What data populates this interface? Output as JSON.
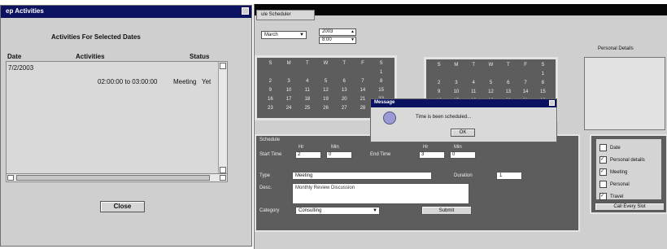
{
  "left_dialog": {
    "title": "ep Activities",
    "heading": "Activities For Selected Dates",
    "columns": [
      "Date",
      "Activities",
      "Status"
    ],
    "rows": [
      {
        "date": "7/2/2003",
        "activity": "",
        "status": ""
      },
      {
        "date": "",
        "activity": "02:00:00 to 03:00:00",
        "status": "Meeting   Yet"
      }
    ],
    "close_label": "Close"
  },
  "right_window": {
    "tab_label": "ule Scheduler",
    "month_select": "March",
    "year_spinner": "2003",
    "hour_spinner": "8:00",
    "right_caption": "Personal Details",
    "calendar1_header": [
      "S",
      "M",
      "T",
      "W",
      "T",
      "F",
      "S"
    ],
    "calendar1_days": [
      "",
      "",
      "",
      "",
      "",
      "",
      "1",
      "2",
      "3",
      "4",
      "5",
      "6",
      "7",
      "8",
      "9",
      "10",
      "11",
      "12",
      "13",
      "14",
      "15",
      "16",
      "17",
      "18",
      "19",
      "20",
      "21",
      "22",
      "23",
      "24",
      "25",
      "26",
      "27",
      "28",
      "29"
    ],
    "calendar2_header": [
      "S",
      "M",
      "T",
      "W",
      "T",
      "F",
      "S"
    ],
    "calendar2_days": [
      "",
      "",
      "",
      "",
      "",
      "",
      "1",
      "2",
      "3",
      "4",
      "5",
      "6",
      "7",
      "8",
      "9",
      "10",
      "11",
      "12",
      "13",
      "14",
      "15",
      "16",
      "17",
      "18",
      "19",
      "20",
      "21",
      "22",
      "23",
      "24",
      "25",
      "26",
      "27",
      "28",
      "29"
    ],
    "schedule_section": "Schedule",
    "start_label": "Start Time",
    "end_label": "End Time",
    "hr_label": "Hr",
    "min_label": "Min",
    "start_hr": "2",
    "start_min": "0",
    "end_hr": "3",
    "end_min": "0",
    "type_label": "Type",
    "type_value": "Meeting",
    "duration_label": "Duration",
    "duration_value": "1",
    "desc_label": "Desc.",
    "desc_value": "Monthly Review Discussion",
    "category_label": "Category",
    "category_value": "Consulting",
    "submit_label": "Submit",
    "checklist": [
      "Date",
      "Personal details",
      "Meeting",
      "Personal",
      "Travel"
    ],
    "checklist_states": [
      false,
      true,
      true,
      false,
      true
    ],
    "bottom_button": "Call Every Slot"
  },
  "message_box": {
    "title": "Message",
    "text": "Time is been scheduled...",
    "ok_label": "OK"
  }
}
